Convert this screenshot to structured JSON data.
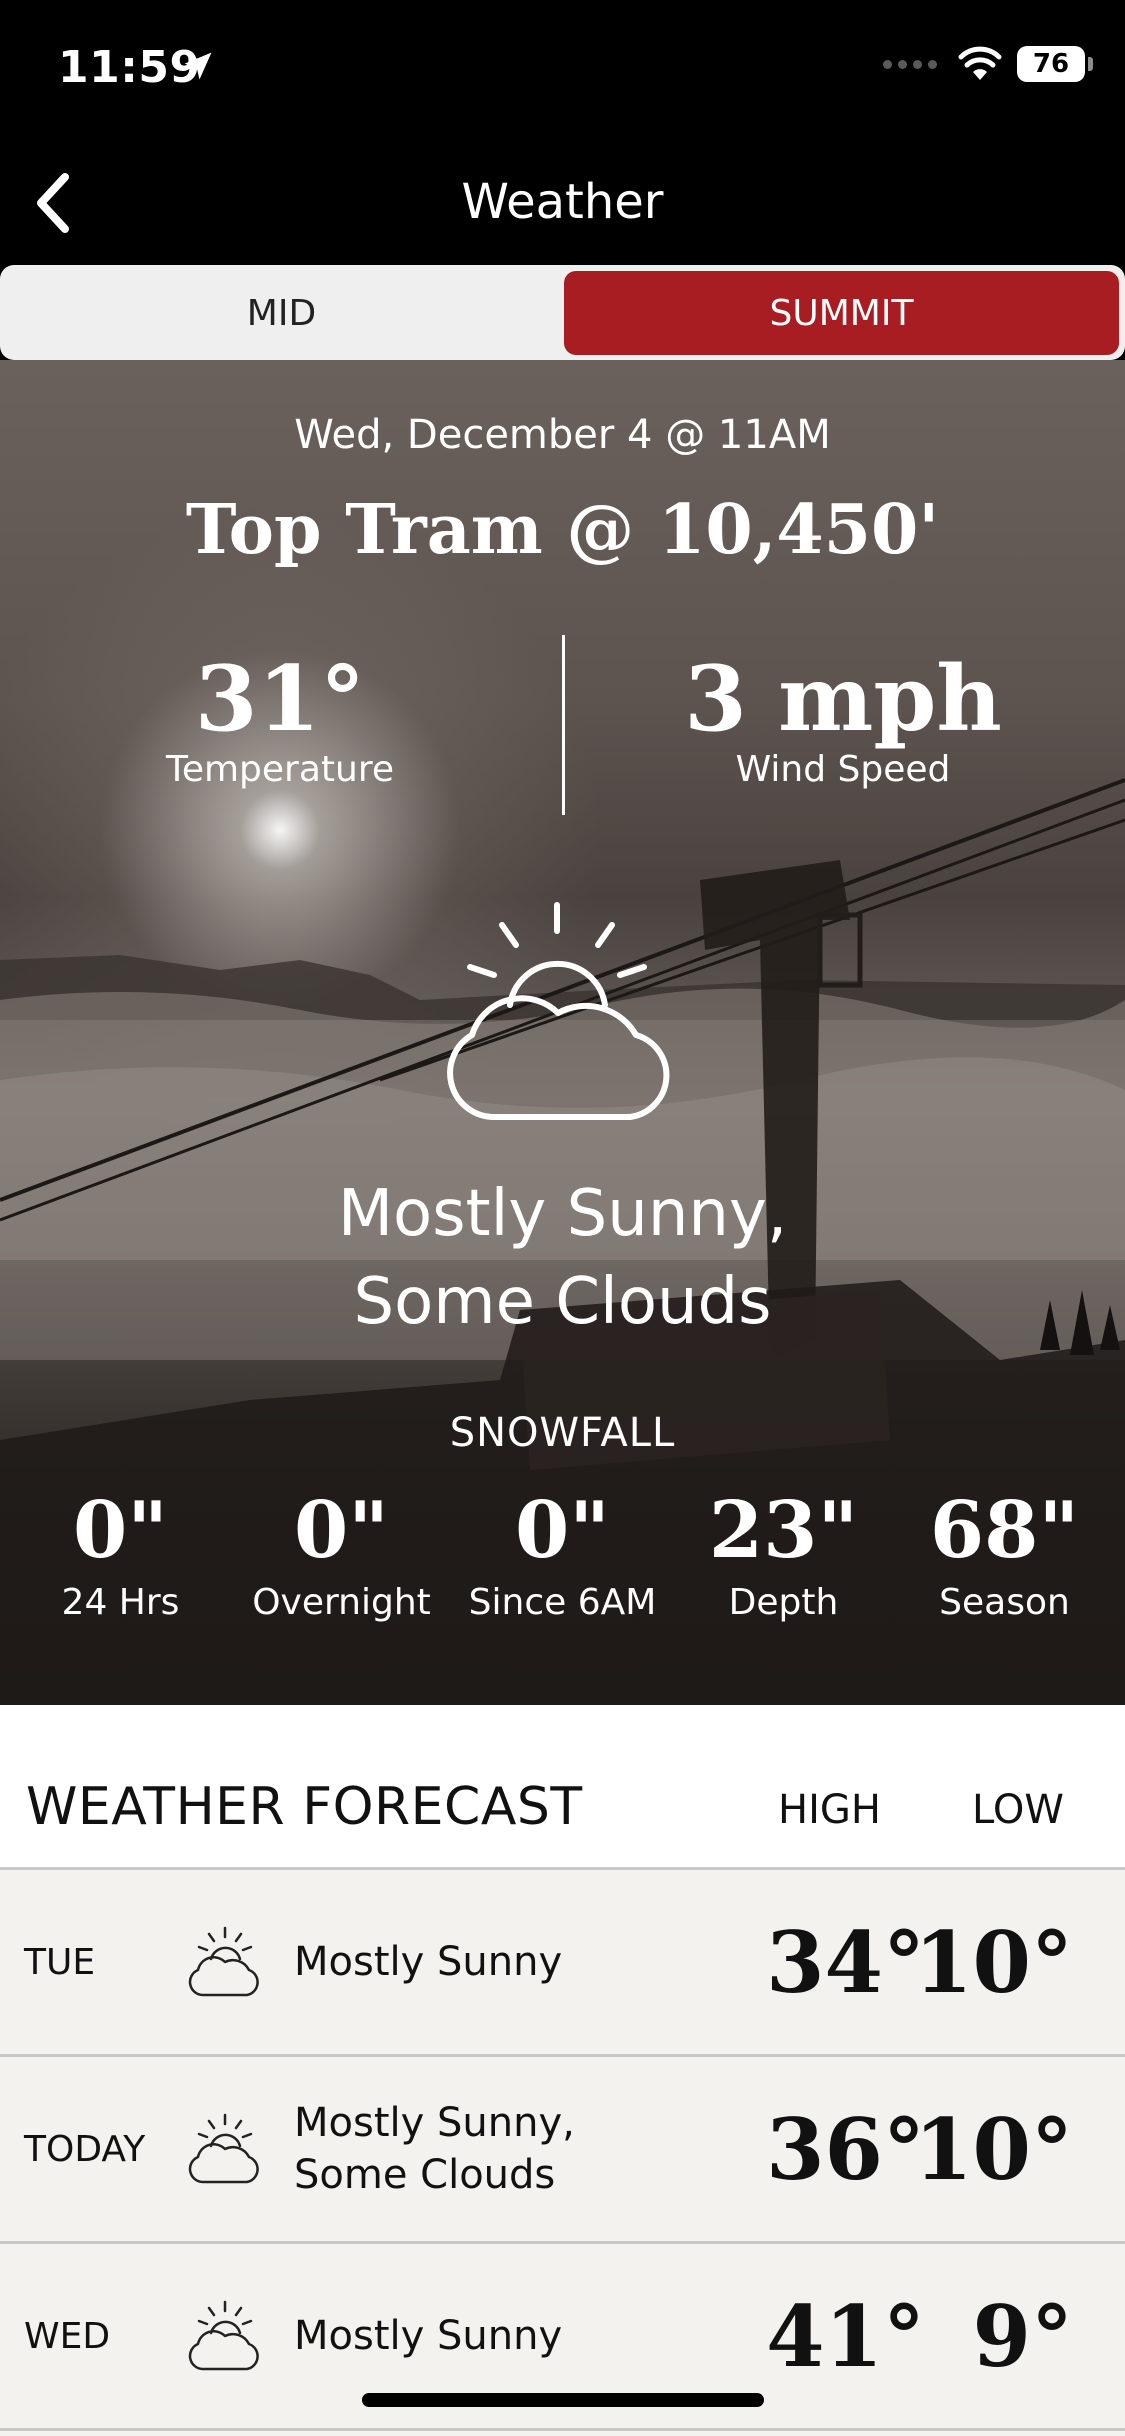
{
  "status": {
    "time": "11:59",
    "battery": "76"
  },
  "nav": {
    "title": "Weather"
  },
  "tabs": {
    "mid": "MID",
    "summit": "SUMMIT",
    "active": "SUMMIT"
  },
  "current": {
    "datetime": "Wed, December 4 @ 11AM",
    "location": "Top Tram @ 10,450'",
    "temperature": "31°",
    "temperature_label": "Temperature",
    "wind": "3 mph",
    "wind_label": "Wind Speed",
    "condition_line1": "Mostly Sunny,",
    "condition_line2": "Some Clouds",
    "condition_icon": "partly-cloudy-icon"
  },
  "snowfall": {
    "heading": "SNOWFALL",
    "items": [
      {
        "value": "0\"",
        "label": "24 Hrs"
      },
      {
        "value": "0\"",
        "label": "Overnight"
      },
      {
        "value": "0\"",
        "label": "Since 6AM"
      },
      {
        "value": "23\"",
        "label": "Depth"
      },
      {
        "value": "68\"",
        "label": "Season"
      }
    ]
  },
  "forecast": {
    "title": "WEATHER FORECAST",
    "high_label": "HIGH",
    "low_label": "LOW",
    "rows": [
      {
        "day": "TUE",
        "line1": "Mostly Sunny",
        "line2": "",
        "high": "34°",
        "low": "10°",
        "icon": "partly-cloudy-icon"
      },
      {
        "day": "TODAY",
        "line1": "Mostly Sunny,",
        "line2": "Some Clouds",
        "high": "36°",
        "low": "10°",
        "icon": "partly-cloudy-icon"
      },
      {
        "day": "WED",
        "line1": "Mostly Sunny",
        "line2": "",
        "high": "41°",
        "low": "9°",
        "icon": "partly-cloudy-icon"
      }
    ]
  },
  "colors": {
    "accent": "#a71d22",
    "forecast_bg": "#f4f2ee"
  }
}
